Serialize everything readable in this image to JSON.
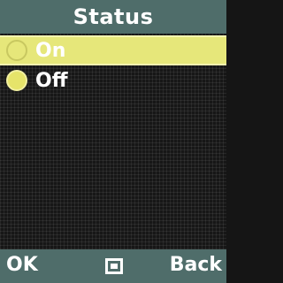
{
  "header": {
    "title": "Status"
  },
  "options": [
    {
      "label": "On",
      "selected": false,
      "highlighted": true
    },
    {
      "label": "Off",
      "selected": true,
      "highlighted": false
    }
  ],
  "softkeys": {
    "left": "OK",
    "center_icon": "select-square-icon",
    "right": "Back"
  },
  "colors": {
    "bar": "#4f6d6a",
    "highlight": "#e6e77a",
    "radio_selected": "#e6e46a",
    "text": "#ffffff"
  }
}
